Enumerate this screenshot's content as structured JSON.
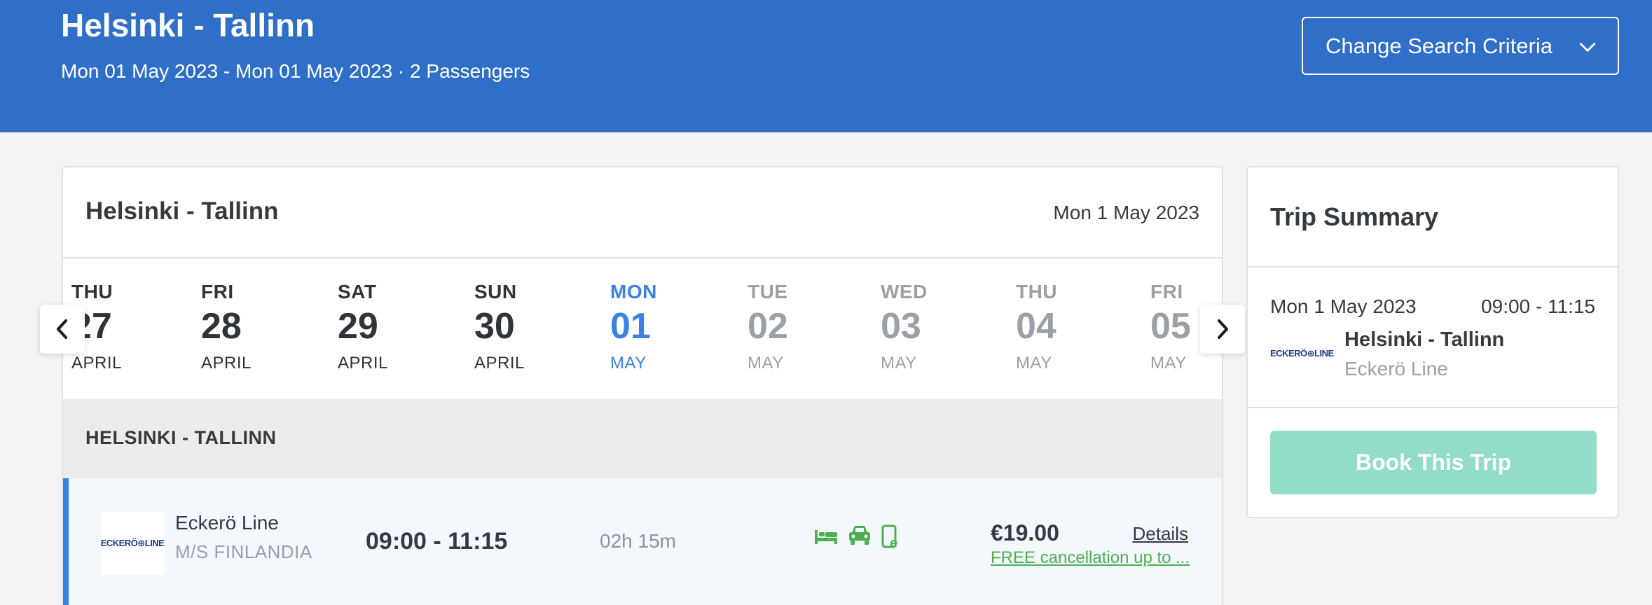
{
  "header": {
    "title": "Helsinki - Tallinn",
    "subtitle": "Mon 01 May 2023 - Mon 01 May 2023 · 2 Passengers",
    "change_label": "Change Search Criteria",
    "bg_color": "#2f6fc7"
  },
  "panel": {
    "title": "Helsinki - Tallinn",
    "date": "Mon 1 May 2023"
  },
  "dates": [
    {
      "dow": "THU",
      "num": "27",
      "month": "APRIL"
    },
    {
      "dow": "FRI",
      "num": "28",
      "month": "APRIL"
    },
    {
      "dow": "SAT",
      "num": "29",
      "month": "APRIL"
    },
    {
      "dow": "SUN",
      "num": "30",
      "month": "APRIL"
    },
    {
      "dow": "MON",
      "num": "01",
      "month": "MAY",
      "active": true
    },
    {
      "dow": "TUE",
      "num": "02",
      "month": "MAY"
    },
    {
      "dow": "WED",
      "num": "03",
      "month": "MAY"
    },
    {
      "dow": "THU",
      "num": "04",
      "month": "MAY"
    },
    {
      "dow": "FRI",
      "num": "05",
      "month": "MAY"
    }
  ],
  "section_label": "HELSINKI - TALLINN",
  "result": {
    "logo_text": "ECKERÖ⊕LINE",
    "operator": "Eckerö Line",
    "vessel": "M/S FINLANDIA",
    "times": "09:00 - 11:15",
    "duration": "02h 15m",
    "amenity_icons": [
      "bed-icon",
      "car-icon",
      "e-ticket-icon"
    ],
    "price": "€19.00",
    "details_label": "Details",
    "cancellation": "FREE cancellation up to ..."
  },
  "summary": {
    "title": "Trip Summary",
    "date": "Mon 1 May 2023",
    "time": "09:00  - 11:15",
    "logo_text": "ECKERÖ⊕LINE",
    "route": "Helsinki - Tallinn",
    "operator": "Eckerö Line",
    "book_label": "Book This Trip",
    "book_color": "#93dcc9"
  },
  "colors": {
    "accent": "#3b82e6",
    "amenity": "#4caf50"
  }
}
